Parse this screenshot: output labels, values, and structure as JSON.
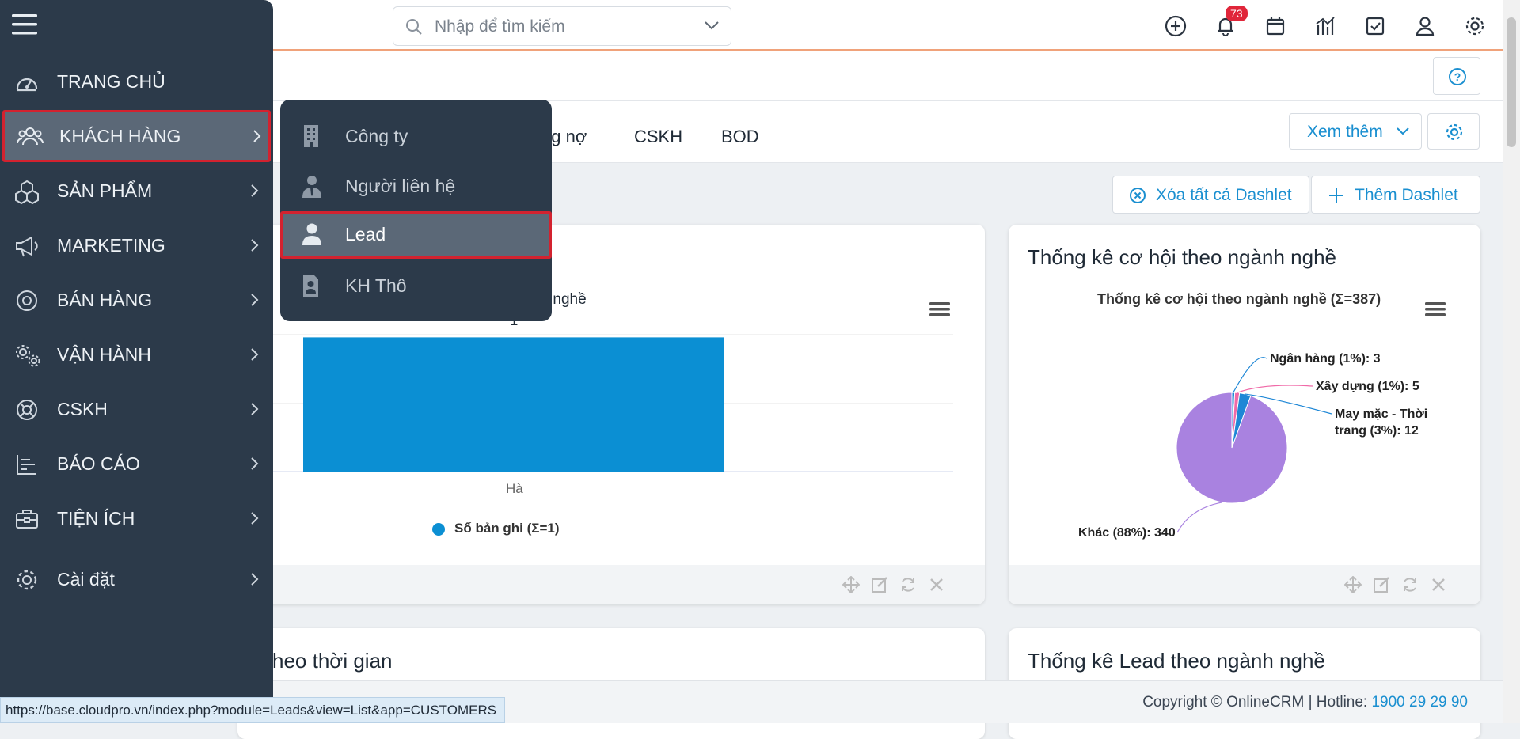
{
  "search": {
    "placeholder": "Nhập để tìm kiếm"
  },
  "header": {
    "notification_count": "73"
  },
  "tabs": [
    {
      "label": "ng nợ"
    },
    {
      "label": "CSKH"
    },
    {
      "label": "BOD"
    }
  ],
  "buttons": {
    "xem_them": "Xem thêm",
    "clear_dashlets": "Xóa tất cả Dashlet",
    "add_dashlet": "Thêm Dashlet"
  },
  "sidebar": {
    "items": [
      {
        "label": "TRANG CHỦ",
        "icon": "dashboard-icon"
      },
      {
        "label": "KHÁCH HÀNG",
        "icon": "users-icon"
      },
      {
        "label": "SẢN PHẨM",
        "icon": "cubes-icon"
      },
      {
        "label": "MARKETING",
        "icon": "megaphone-icon"
      },
      {
        "label": "BÁN HÀNG",
        "icon": "target-icon"
      },
      {
        "label": "VẬN HÀNH",
        "icon": "gears-icon"
      },
      {
        "label": "CSKH",
        "icon": "lifebuoy-icon"
      },
      {
        "label": "BÁO CÁO",
        "icon": "report-icon"
      },
      {
        "label": "TIỆN ÍCH",
        "icon": "briefcase-icon"
      },
      {
        "label": "Cài đặt",
        "icon": "gear-icon"
      }
    ]
  },
  "submenu": {
    "items": [
      {
        "label": "Công ty",
        "icon": "building-icon"
      },
      {
        "label": "Người liên hệ",
        "icon": "contact-person-icon"
      },
      {
        "label": "Lead",
        "icon": "person-icon"
      },
      {
        "label": "KH Thô",
        "icon": "badge-icon"
      }
    ]
  },
  "dashlets": {
    "left_top": {
      "subtitle_fragment": "nh nghề",
      "bar_label": "1",
      "category": "Hà",
      "legend": "Số bản ghi (Σ=1)"
    },
    "right_top": {
      "title": "Thống kê cơ hội theo ngành nghề",
      "chart_title": "Thống kê cơ hội theo ngành nghề (Σ=387)"
    },
    "left_bottom": {
      "title_fragment": "heo thời gian"
    },
    "right_bottom": {
      "title": "Thống kê Lead theo ngành nghề"
    }
  },
  "chart_data": [
    {
      "type": "bar",
      "categories": [
        "Hà"
      ],
      "series": [
        {
          "name": "Số bản ghi (Σ=1)",
          "values": [
            1
          ],
          "color": "#0b8fd3"
        }
      ]
    },
    {
      "type": "pie",
      "title": "Thống kê cơ hội theo ngành nghề (Σ=387)",
      "slices": [
        {
          "label": "Ngân hàng (1%): 3",
          "value": 3,
          "color": "#1e87d6"
        },
        {
          "label": "Xây dựng (1%): 5",
          "value": 5,
          "color": "#f06aa8"
        },
        {
          "label": "May mặc - Thời trang (3%): 12",
          "value": 12,
          "color": "#1e87d6"
        },
        {
          "label": "Khác (88%): 340",
          "value": 340,
          "color": "#a982e0"
        }
      ]
    }
  ],
  "footer": {
    "copyright": "Copyright © OnlineCRM",
    "hotline_label": "Hotline:",
    "hotline": "1900 29 29 90"
  },
  "status_url": "https://base.cloudpro.vn/index.php?module=Leads&view=List&app=CUSTOMERS",
  "colors": {
    "accent": "#1a8fd0",
    "sidebar": "#2c3a4a",
    "highlight": "#d3222f"
  }
}
